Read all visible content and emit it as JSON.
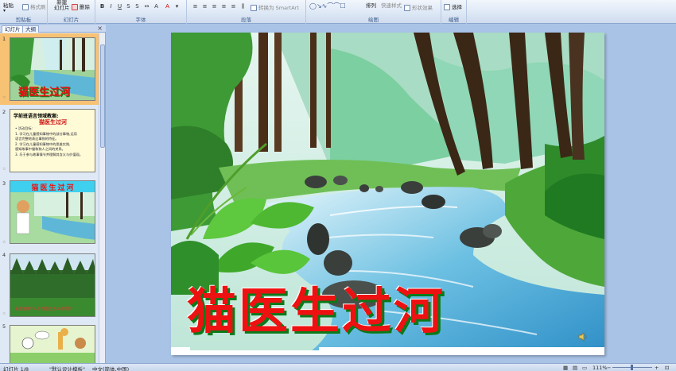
{
  "ribbon": {
    "clipboard": {
      "paste": "粘贴",
      "format_painter": "格式刷",
      "label": "剪贴板"
    },
    "slides": {
      "new_slide_line1": "新建",
      "new_slide_line2": "幻灯片",
      "delete": "删除",
      "label": "幻灯片"
    },
    "font": {
      "label": "字体"
    },
    "paragraph": {
      "convert_smartart": "转换为 SmartArt",
      "label": "段落"
    },
    "drawing": {
      "arrange": "排列",
      "quick_styles": "快速样式",
      "shape_effects": "形状效果",
      "label": "绘图"
    },
    "editing": {
      "select": "选择",
      "label": "编辑"
    }
  },
  "panel": {
    "tab_slides": "幻灯片",
    "tab_outline": "大纲",
    "close_glyph": "×",
    "slides": [
      {
        "number": "1",
        "title": "猫医生过河"
      },
      {
        "number": "2",
        "header": "学前班语言领域教案:",
        "title": "猫医生过河",
        "lines": [
          "• 活动目标:",
          "1. 学习在儿童感知事物中的部分事物,运用",
          "   语言完整地表达事物的特征。",
          "2. 学习在儿童感知事物中的思维实践,",
          "   感知故事中猫和狗人之间的关系。",
          "3. 乐于参与故事情节并理解其含义与价值观。"
        ]
      },
      {
        "number": "3",
        "title": "猫医生过河"
      },
      {
        "number": "4",
        "caption": "猫医生做什么了?猫医生怎么过河呢?"
      },
      {
        "number": "5"
      }
    ]
  },
  "slide": {
    "title": "猫医生过河"
  },
  "status": {
    "slide_indicator": "幻灯片 1/8",
    "theme": "\"默认设计模板\"",
    "language": "中文(简体,中国)",
    "zoom": "111%"
  }
}
